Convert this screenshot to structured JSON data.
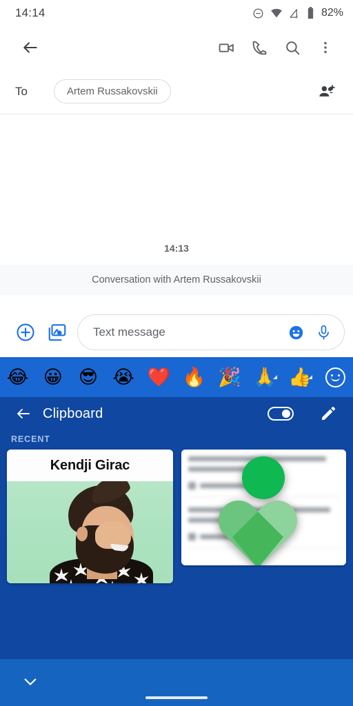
{
  "status_bar": {
    "time": "14:14",
    "battery_percent": "82%",
    "icons": [
      "do-not-disturb-icon",
      "wifi-icon",
      "cellular-signal-off-icon",
      "battery-icon"
    ]
  },
  "toolbar": {
    "back": "back-arrow-icon",
    "video_call": "video-call-icon",
    "voice_call": "phone-icon",
    "search": "search-icon",
    "overflow": "more-vert-icon"
  },
  "recipient_row": {
    "to_label": "To",
    "chip_name": "Artem Russakovskii",
    "add_people": "add-people-icon"
  },
  "conversation": {
    "timestamp": "14:13",
    "banner": "Conversation with Artem Russakovskii"
  },
  "compose": {
    "attach_icon": "plus-circle-icon",
    "gallery_icon": "image-camera-icon",
    "placeholder": "Text message",
    "emoji_icon": "emoji-smile-icon",
    "mic_icon": "microphone-icon"
  },
  "emoji_bar": {
    "emojis": [
      "😂",
      "😀",
      "😎",
      "😭",
      "❤️",
      "🔥",
      "🎉",
      "🙏",
      "👍"
    ],
    "picker_icon": "emoji-picker-icon"
  },
  "clipboard": {
    "back": "back-arrow-icon",
    "title": "Clipboard",
    "toggle": "clipboard-sync-toggle",
    "toggle_state": "on",
    "edit_icon": "pencil-edit-icon",
    "section_label": "RECENT",
    "cards": [
      {
        "title": "Kendji Girac",
        "type": "image-clip"
      },
      {
        "title": "",
        "type": "screenshot-clip"
      }
    ]
  },
  "bottom_bar": {
    "collapse_icon": "chevron-down-icon",
    "home_indicator": "home-indicator"
  },
  "colors": {
    "emoji_bar_blue": "#1967d2",
    "clipboard_blue": "#0f47a1",
    "bottom_bar_blue": "#1565c0",
    "accent_blue": "#1a73e8",
    "fit_green": "#0fb851"
  }
}
